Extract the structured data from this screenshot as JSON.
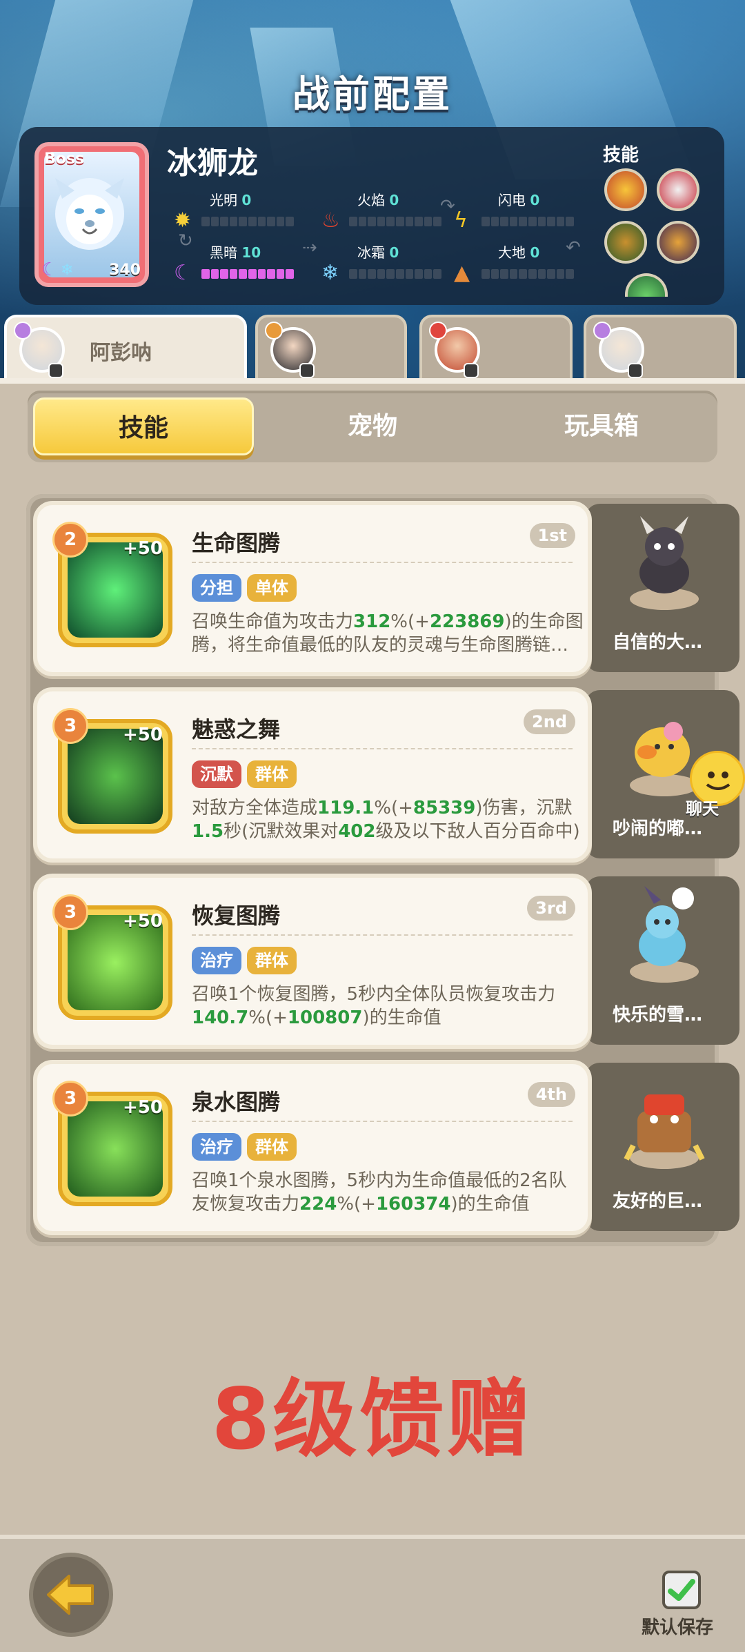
{
  "page": {
    "title": "战前配置"
  },
  "boss": {
    "tag": "Boss",
    "name": "冰狮龙",
    "level": "340",
    "stats": [
      {
        "label": "光明",
        "value": "0",
        "filled": 0,
        "icon": "sun-icon"
      },
      {
        "label": "火焰",
        "value": "0",
        "filled": 0,
        "icon": "fire-icon"
      },
      {
        "label": "闪电",
        "value": "0",
        "filled": 0,
        "icon": "lightning-icon"
      },
      {
        "label": "黑暗",
        "value": "10",
        "filled": 10,
        "icon": "moon-icon"
      },
      {
        "label": "冰霜",
        "value": "0",
        "filled": 0,
        "icon": "snowflake-icon"
      },
      {
        "label": "大地",
        "value": "0",
        "filled": 0,
        "icon": "earth-icon"
      }
    ],
    "skills_label": "技能"
  },
  "heroes": [
    {
      "name": "阿彭呐",
      "active": true
    },
    {
      "name": "",
      "active": false
    },
    {
      "name": "",
      "active": false
    },
    {
      "name": "",
      "active": false
    }
  ],
  "tabs": [
    {
      "label": "技能",
      "active": true
    },
    {
      "label": "宠物",
      "active": false
    },
    {
      "label": "玩具箱",
      "active": false
    }
  ],
  "skills": [
    {
      "name": "生命图腾",
      "rank": "1st",
      "level": "2",
      "bonus": "+50",
      "tags": [
        {
          "text": "分担",
          "color": "blue"
        },
        {
          "text": "单体",
          "color": "gold"
        }
      ],
      "desc_parts": [
        "召唤生命值为攻击力",
        "312",
        "%(+",
        "223869",
        ")的生命图腾，将生命值最低的队友的灵魂与生命图腾链…"
      ],
      "pet": "自信的大…"
    },
    {
      "name": "魅惑之舞",
      "rank": "2nd",
      "level": "3",
      "bonus": "+50",
      "tags": [
        {
          "text": "沉默",
          "color": "red"
        },
        {
          "text": "群体",
          "color": "gold"
        }
      ],
      "desc_parts": [
        "对敌方全体造成",
        "119.1",
        "%(+",
        "85339",
        ")伤害，沉默",
        "1.5",
        "秒(沉默效果对",
        "402",
        "级及以下敌人百分百命中)"
      ],
      "pet": "吵闹的嘟…"
    },
    {
      "name": "恢复图腾",
      "rank": "3rd",
      "level": "3",
      "bonus": "+50",
      "tags": [
        {
          "text": "治疗",
          "color": "blue"
        },
        {
          "text": "群体",
          "color": "gold"
        }
      ],
      "desc_parts": [
        "召唤1个恢复图腾，5秒内全体队员恢复攻击力",
        "140.7",
        "%(+",
        "100807",
        ")的生命值"
      ],
      "pet": "快乐的雪…"
    },
    {
      "name": "泉水图腾",
      "rank": "4th",
      "level": "3",
      "bonus": "+50",
      "tags": [
        {
          "text": "治疗",
          "color": "blue"
        },
        {
          "text": "群体",
          "color": "gold"
        }
      ],
      "desc_parts": [
        "召唤1个泉水图腾，5秒内为生命值最低的2名队友恢复攻击力",
        "224",
        "%(+",
        "160374",
        ")的生命值"
      ],
      "pet": "友好的巨…"
    }
  ],
  "promo_text": "8级馈赠",
  "chat_label": "聊天",
  "save_label": "默认保存"
}
